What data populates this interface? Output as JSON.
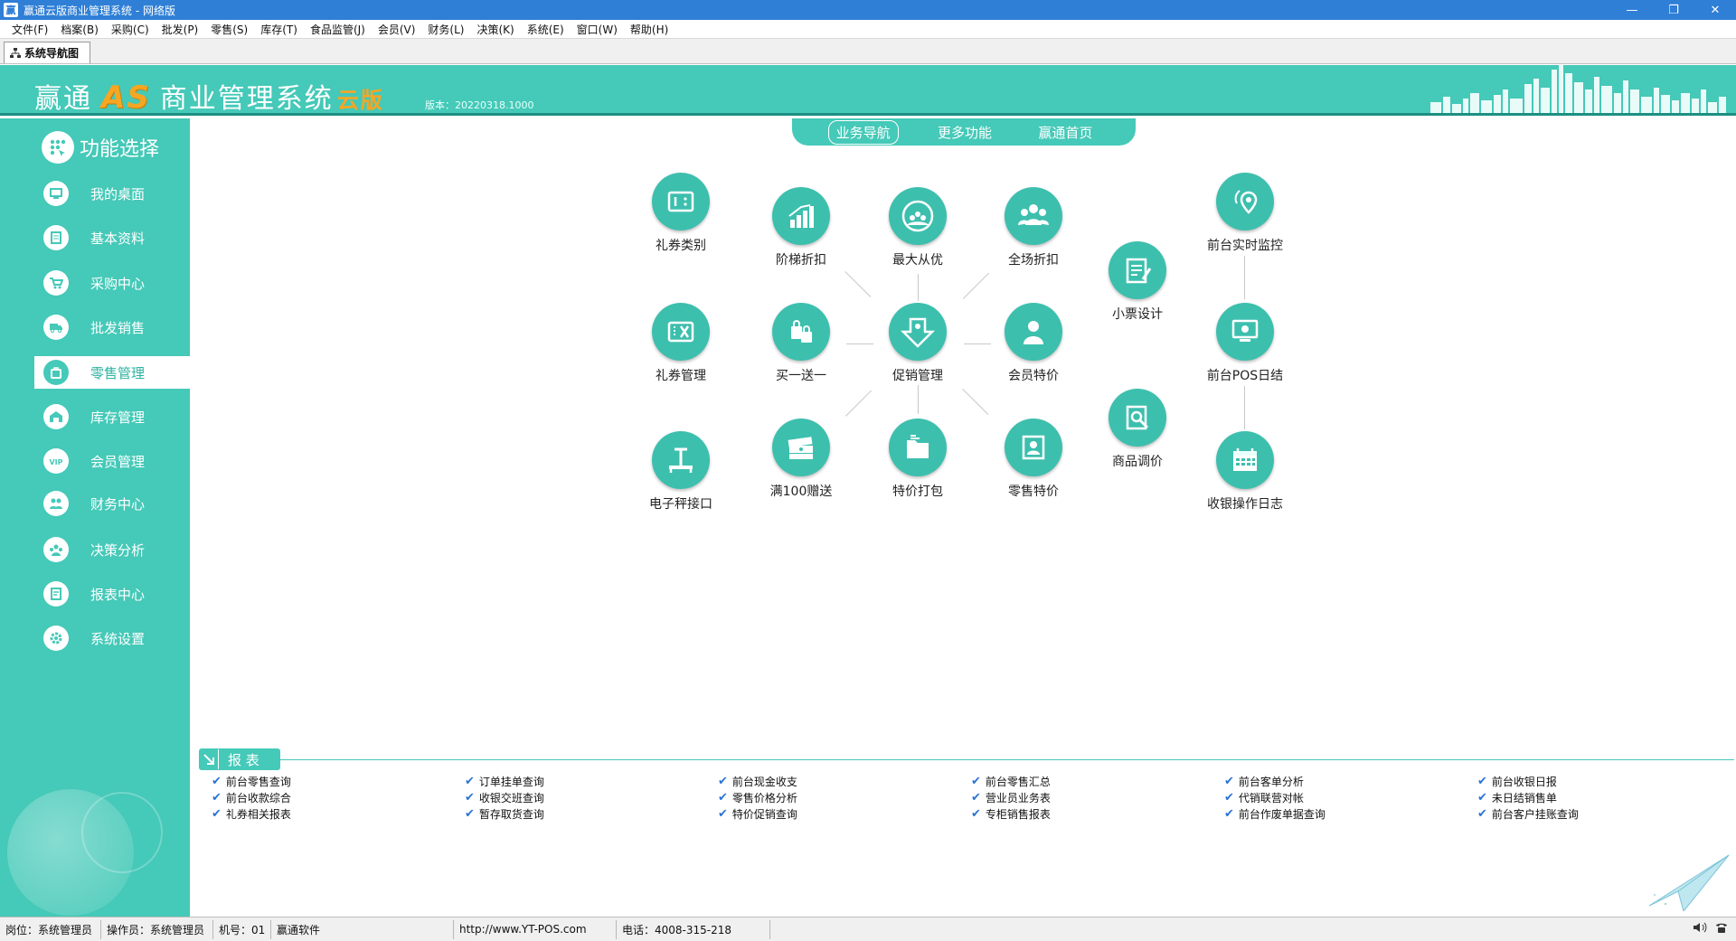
{
  "window": {
    "title": "赢通云版商业管理系统 - 网络版",
    "min_glyph": "—",
    "restore_glyph": "❐",
    "close_glyph": "✕"
  },
  "menu": [
    {
      "label": "文件(F)"
    },
    {
      "label": "档案(B)"
    },
    {
      "label": "采购(C)"
    },
    {
      "label": "批发(P)"
    },
    {
      "label": "零售(S)"
    },
    {
      "label": "库存(T)"
    },
    {
      "label": "食品监管(J)"
    },
    {
      "label": "会员(V)"
    },
    {
      "label": "财务(L)"
    },
    {
      "label": "决策(K)"
    },
    {
      "label": "系统(E)"
    },
    {
      "label": "窗口(W)"
    },
    {
      "label": "帮助(H)"
    }
  ],
  "doc_tab": {
    "label": "系统导航图"
  },
  "banner": {
    "logo_part1": "赢通",
    "logo_as": "AS",
    "logo_part2": "商业管理系统",
    "logo_cloud": "云版",
    "version": "版本：20220318.1000"
  },
  "sidebar": {
    "title": "功能选择",
    "items": [
      {
        "label": "我的桌面",
        "icon": "monitor-icon"
      },
      {
        "label": "基本资料",
        "icon": "document-icon"
      },
      {
        "label": "采购中心",
        "icon": "cart-icon"
      },
      {
        "label": "批发销售",
        "icon": "truck-icon"
      },
      {
        "label": "零售管理",
        "icon": "bag-icon",
        "active": true
      },
      {
        "label": "库存管理",
        "icon": "warehouse-icon"
      },
      {
        "label": "会员管理",
        "icon": "vip-icon"
      },
      {
        "label": "财务中心",
        "icon": "finance-icon"
      },
      {
        "label": "决策分析",
        "icon": "decision-icon"
      },
      {
        "label": "报表中心",
        "icon": "report-icon"
      },
      {
        "label": "系统设置",
        "icon": "gear-icon"
      }
    ]
  },
  "nav_tabs": [
    {
      "label": "业务导航",
      "active": true
    },
    {
      "label": "更多功能"
    },
    {
      "label": "赢通首页"
    }
  ],
  "functions": [
    {
      "label": "礼券类别",
      "icon": "coupon-category-icon"
    },
    {
      "label": "阶梯折扣",
      "icon": "bar-chart-icon"
    },
    {
      "label": "最大从优",
      "icon": "best-offer-icon"
    },
    {
      "label": "全场折扣",
      "icon": "people-icon"
    },
    {
      "label": "小票设计",
      "icon": "receipt-edit-icon"
    },
    {
      "label": "前台实时监控",
      "icon": "location-pin-icon"
    },
    {
      "label": "礼券管理",
      "icon": "coupon-manage-icon"
    },
    {
      "label": "买一送一",
      "icon": "shopping-bags-icon"
    },
    {
      "label": "促销管理",
      "icon": "promotion-icon"
    },
    {
      "label": "会员特价",
      "icon": "member-icon"
    },
    {
      "label": "前台POS日结",
      "icon": "pos-monitor-icon"
    },
    {
      "label": "电子秤接口",
      "icon": "scale-icon"
    },
    {
      "label": "满100赠送",
      "icon": "cash-stack-icon"
    },
    {
      "label": "特价打包",
      "icon": "folder-icon"
    },
    {
      "label": "零售特价",
      "icon": "badge-card-icon"
    },
    {
      "label": "商品调价",
      "icon": "price-search-icon"
    },
    {
      "label": "收银操作日志",
      "icon": "calendar-icon"
    }
  ],
  "report": {
    "tab_label": "报 表",
    "columns": [
      [
        "前台零售查询",
        "前台收款综合",
        "礼券相关报表"
      ],
      [
        "订单挂单查询",
        "收银交班查询",
        "暂存取货查询"
      ],
      [
        "前台现金收支",
        "零售价格分析",
        "特价促销查询"
      ],
      [
        "前台零售汇总",
        "营业员业务表",
        "专柜销售报表"
      ],
      [
        "前台客单分析",
        "代销联营对帐",
        "前台作废单据查询"
      ],
      [
        "前台收银日报",
        "未日结销售单",
        "前台客户挂账查询"
      ]
    ]
  },
  "status": {
    "post": "岗位：系统管理员",
    "operator": "操作员：系统管理员",
    "machine": "机号：01",
    "company": "赢通软件",
    "url": "http://www.YT-POS.com",
    "phone": "电话：4008-315-218"
  },
  "colors": {
    "teal": "#45c9b8",
    "teal_dark": "#1c8f82",
    "logo_accent": "#f5a623",
    "titlebar": "#2f7fd6",
    "check": "#2a73d4"
  }
}
